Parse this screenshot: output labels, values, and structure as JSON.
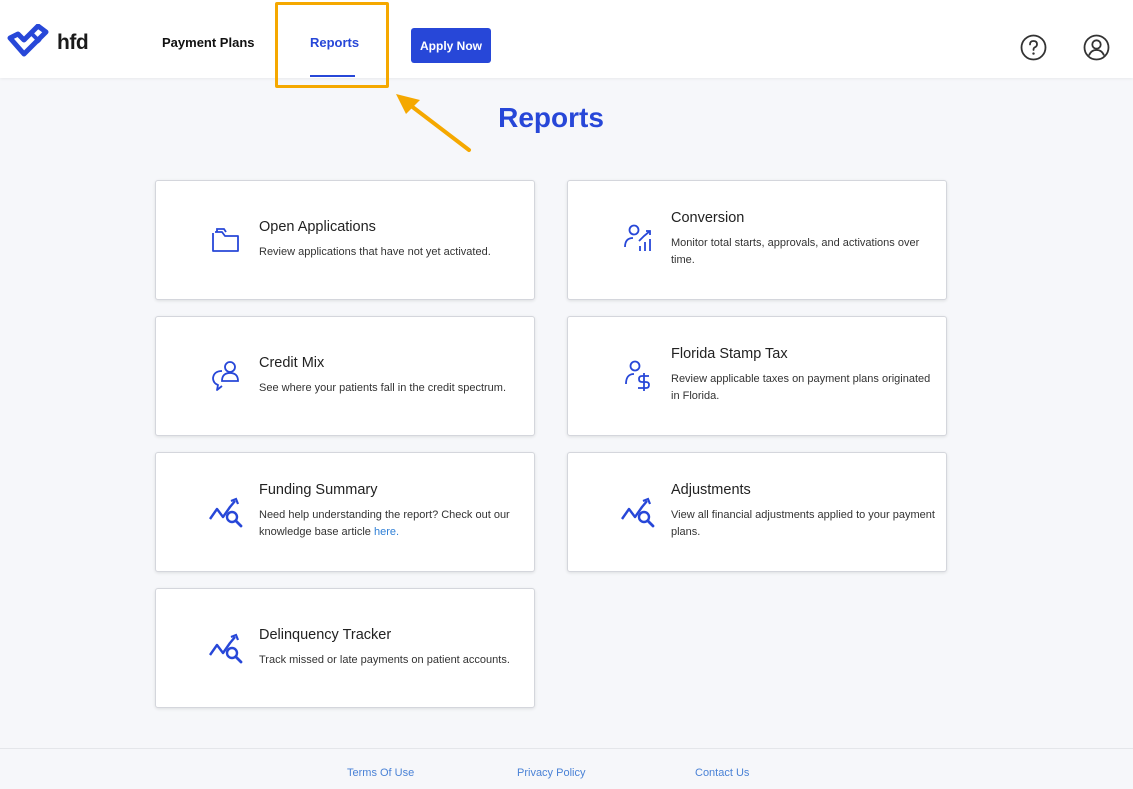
{
  "header": {
    "logo_text": "hfd",
    "nav": {
      "payment_plans": "Payment Plans",
      "reports": "Reports"
    },
    "apply_button": "Apply Now"
  },
  "page": {
    "title": "Reports"
  },
  "cards": [
    {
      "title": "Open Applications",
      "desc": "Review applications that have not yet activated.",
      "icon": "folder-icon"
    },
    {
      "title": "Conversion",
      "desc": "Monitor total starts, approvals, and activations over time.",
      "icon": "user-growth-chart-icon"
    },
    {
      "title": "Credit Mix",
      "desc": "See where your patients fall in the credit spectrum.",
      "icon": "user-chat-icon"
    },
    {
      "title": "Florida Stamp Tax",
      "desc": "Review applicable taxes on payment plans originated in Florida.",
      "icon": "user-dollar-icon"
    },
    {
      "title": "Funding Summary",
      "desc": "Need help understanding the report? Check out our knowledge base article ",
      "link": "here.",
      "icon": "chart-search-icon"
    },
    {
      "title": "Adjustments",
      "desc": "View all financial adjustments applied to your payment plans.",
      "icon": "chart-search-icon"
    },
    {
      "title": "Delinquency Tracker",
      "desc": "Track missed or late payments on patient accounts.",
      "icon": "chart-search-icon"
    }
  ],
  "footer": {
    "terms": "Terms Of Use",
    "privacy": "Privacy Policy",
    "contact": "Contact Us"
  },
  "colors": {
    "accent": "#2747d8",
    "highlight": "#f5a800",
    "link": "#2f7fd6",
    "background": "#f6f7fa"
  }
}
